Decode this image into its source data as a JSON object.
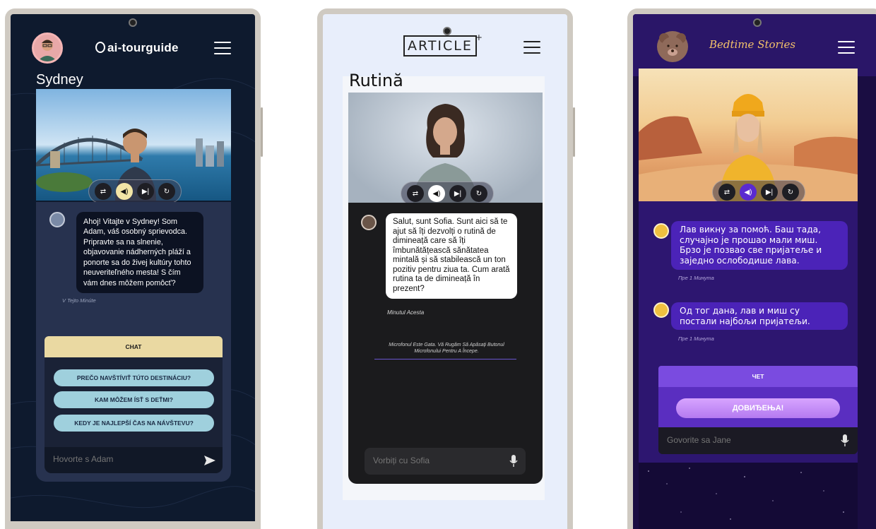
{
  "phone1": {
    "logo": "ai-tourguide",
    "title": "Sydney",
    "message": "Ahoj! Vitajte v Sydney! Som Adam, váš osobný sprievodca. Pripravte sa na slnenie, objavovanie nádherných pláží a ponorte sa do živej kultúry tohto neuveriteľného mesta! S čím vám dnes môžem pomôcť?",
    "time": "V Tejto Minúte",
    "chat_tab": "CHAT",
    "suggestions": [
      "PREČO NAVŠTÍVIŤ TÚTO DESTINÁCIU?",
      "KAM MÔŽEM ÍSŤ S DEŤMI?",
      "KEDY JE NAJLEPŠÍ ČAS NA NÁVŠTEVU?"
    ],
    "input_placeholder": "Hovorte s Adam"
  },
  "phone2": {
    "logo": "ARTICLE",
    "logo_sup": "+",
    "title": "Rutină",
    "message": "Salut, sunt Sofia. Sunt aici să te ajut să îți dezvolți o rutină de dimineață care să îți îmbunătățească sănătatea mintală și să stabilească un ton pozitiv pentru ziua ta. Cum arată rutina ta de dimineață în prezent?",
    "time": "Minutul Acesta",
    "mic_note": "Microfonul Este Gata. Vă Rugăm Să Apăsați Butonul Microfonului Pentru A Începe.",
    "input_placeholder": "Vorbiți cu Sofia"
  },
  "phone3": {
    "logo": "Bedtime Stories",
    "messages": [
      {
        "text": "Лав викну за помоћ. Баш тада, случајно је прошао мали миш. Брзо је позвао све пријатеље и заједно ослободише лава.",
        "time": "Пре 1 Минута"
      },
      {
        "text": "Од тог дана, лав и миш су постали најбољи пријатељи.",
        "time": "Пре 1 Минута"
      }
    ],
    "chat_tab": "ЧЕТ",
    "goodbye_button": "ДОВИЂЕЊА!",
    "input_placeholder": "Govorite sa Jane"
  },
  "controls": {
    "repeat": "⇄",
    "volume": "◀)",
    "skip": "▶|",
    "reload": "↻"
  },
  "colors": {
    "p1_accent": "#ead9a2",
    "p2_accent": "#6a55d0",
    "p3_accent": "#4b23b8"
  }
}
